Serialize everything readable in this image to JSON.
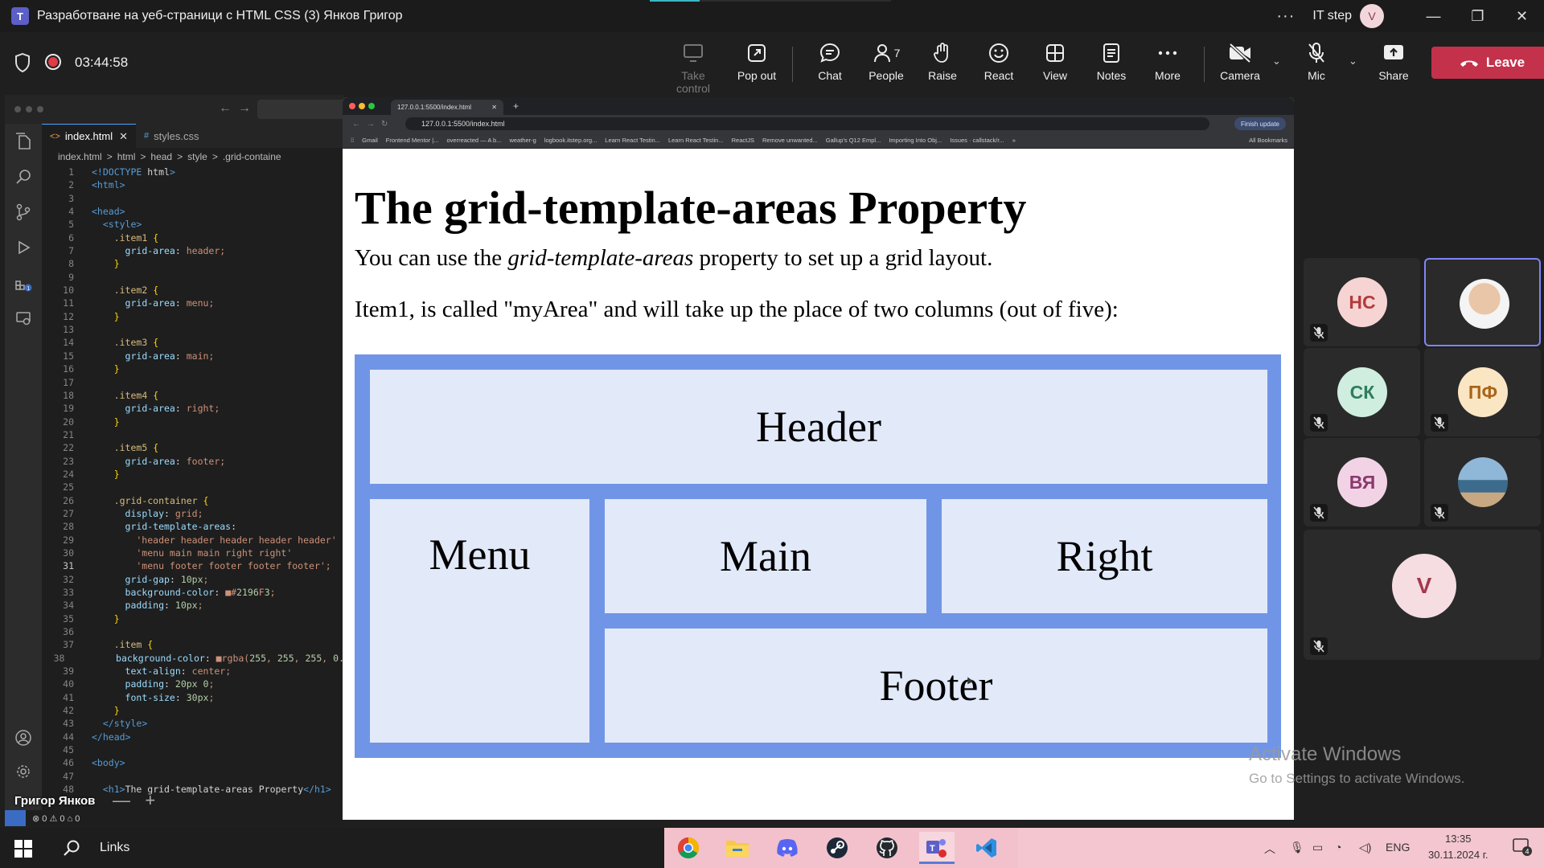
{
  "window": {
    "title": "Разработване на уеб-страници с HTML CSS (3) Янков Григор",
    "org": "IT step",
    "user_initial": "V"
  },
  "meeting": {
    "timer": "03:44:58",
    "controls": [
      {
        "label": "Take control"
      },
      {
        "label": "Pop out"
      },
      {
        "label": "Chat"
      },
      {
        "label": "People",
        "count": "7"
      },
      {
        "label": "Raise"
      },
      {
        "label": "React"
      },
      {
        "label": "View"
      },
      {
        "label": "Notes"
      },
      {
        "label": "More"
      },
      {
        "label": "Camera"
      },
      {
        "label": "Mic"
      },
      {
        "label": "Share"
      }
    ],
    "leave_label": "Leave",
    "presenter_name": "Григор Янков"
  },
  "vscode": {
    "tabs": [
      {
        "label": "index.html",
        "icon": "<>"
      },
      {
        "label": "styles.css",
        "icon": "#"
      }
    ],
    "breadcrumbs": [
      "index.html",
      ">",
      "html",
      ">",
      "head",
      ">",
      "style",
      ">",
      ".grid-containe"
    ],
    "current_line": 31,
    "lines": [
      "<!DOCTYPE html>",
      "<html>",
      "",
      "<head>",
      "  <style>",
      "    .item1 {",
      "      grid-area: header;",
      "    }",
      "",
      "    .item2 {",
      "      grid-area: menu;",
      "    }",
      "",
      "    .item3 {",
      "      grid-area: main;",
      "    }",
      "",
      "    .item4 {",
      "      grid-area: right;",
      "    }",
      "",
      "    .item5 {",
      "      grid-area: footer;",
      "    }",
      "",
      "    .grid-container {",
      "      display: grid;",
      "      grid-template-areas:",
      "        'header header header header header'",
      "        'menu main main right right'",
      "        'menu footer footer footer footer';",
      "      grid-gap: 10px;",
      "      background-color: ■#2196F3;",
      "      padding: 10px;",
      "    }",
      "",
      "    .item {",
      "      background-color: ■rgba(255, 255, 255, 0.",
      "      text-align: center;",
      "      padding: 20px 0;",
      "      font-size: 30px;",
      "    }",
      "  </style>",
      "</head>",
      "",
      "<body>",
      "",
      "  <h1>The grid-template-areas Property</h1>"
    ],
    "status": "⊗ 0 ⚠ 0   ⌂ 0"
  },
  "browser": {
    "tab_title": "127.0.0.1:5500/index.html",
    "url": "127.0.0.1:5500/index.html",
    "update_label": "Finish update",
    "bookmarks": [
      "Gmail",
      "Frontend Mentor |...",
      "overreacted — A b...",
      "weather-g",
      "logbook.itstep.org...",
      "Learn React Testin...",
      "Learn React Testin...",
      "ReactJS",
      "Remove unwanted...",
      "Gallup's Q12 Empl...",
      "Importing Into Obj...",
      "Issues · callstack/r..."
    ],
    "all_bookmarks": "All Bookmarks"
  },
  "page": {
    "heading": "The grid-template-areas Property",
    "p1_before": "You can use the ",
    "p1_em": "grid-template-areas",
    "p1_after": " property to set up a grid layout.",
    "p2": "Item1, is called \"myArea\" and will take up the place of two columns (out of five):",
    "grid": {
      "header": "Header",
      "menu": "Menu",
      "main": "Main",
      "right": "Right",
      "footer": "Footer"
    }
  },
  "participants": [
    {
      "initials": "НС",
      "bg": "#f6d4d4",
      "fg": "#b43b3b"
    },
    {
      "initials": "",
      "photo": true,
      "active": true
    },
    {
      "initials": "СК",
      "bg": "#cfeee0",
      "fg": "#2e7d5b"
    },
    {
      "initials": "ПФ",
      "bg": "#fbe6c4",
      "fg": "#a7661a"
    },
    {
      "initials": "ВЯ",
      "bg": "#f2d3e6",
      "fg": "#8a3a6e"
    },
    {
      "initials": "",
      "photo": true
    },
    {
      "initials": "V",
      "bg": "#f5dde2",
      "fg": "#a4374d"
    }
  ],
  "watermark": {
    "line1": "Activate Windows",
    "line2": "Go to Settings to activate Windows."
  },
  "taskbar": {
    "links_label": "Links",
    "lang": "ENG",
    "time": "13:35",
    "date": "30.11.2024 г.",
    "notif_count": "4"
  },
  "colors": {
    "grid_bg": "#2196F3",
    "leave": "#c4314b",
    "accent": "#7f85f5"
  }
}
